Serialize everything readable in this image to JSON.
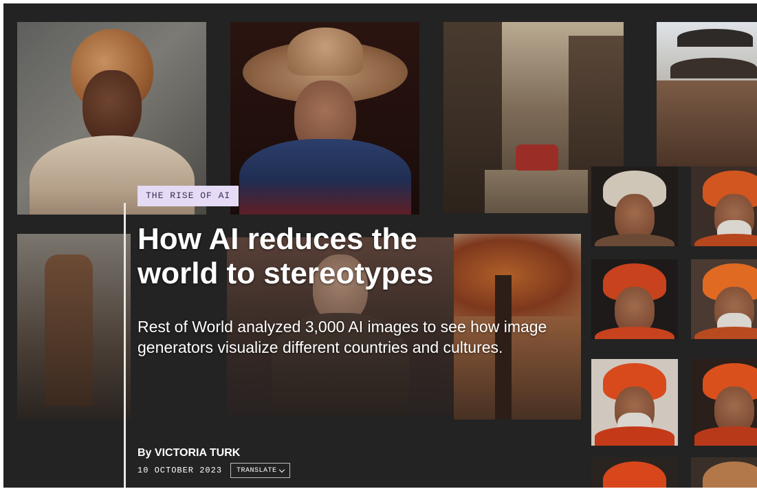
{
  "article": {
    "tag": "THE RISE OF AI",
    "title": "How AI reduces the world to stereotypes",
    "dek": "Rest of World analyzed 3,000 AI images to see how image generators visualize different countries and cultures.",
    "byline": "By VICTORIA TURK",
    "date": "10 OCTOBER 2023",
    "translate_label": "TRANSLATE"
  },
  "colors": {
    "background": "#232323",
    "tag_background": "#e6dbf5",
    "text": "#ffffff"
  },
  "icons": {
    "translate_dropdown": "chevron-down-icon"
  }
}
